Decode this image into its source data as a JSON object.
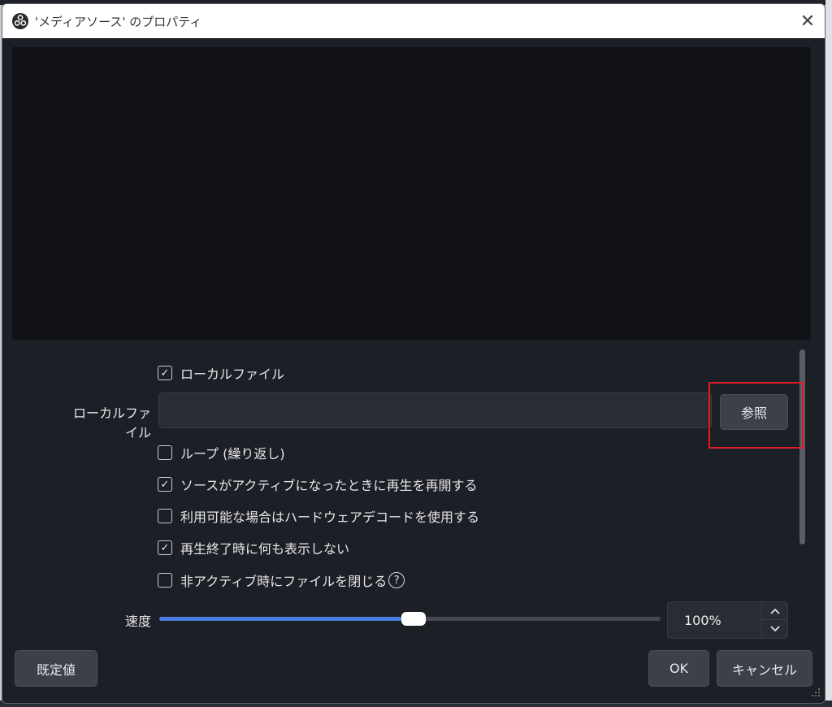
{
  "window": {
    "title": "'メディアソース' のプロパティ",
    "close_glyph": "✕"
  },
  "properties": {
    "local_file_checkbox": {
      "label": "ローカルファイル",
      "checked": true
    },
    "local_file_field": {
      "label": "ローカルファイル",
      "value": ""
    },
    "browse_button": "参照",
    "checkboxes": [
      {
        "label": "ループ (繰り返し)",
        "checked": false
      },
      {
        "label": "ソースがアクティブになったときに再生を再開する",
        "checked": true
      },
      {
        "label": "利用可能な場合はハードウェアデコードを使用する",
        "checked": false
      },
      {
        "label": "再生終了時に何も表示しない",
        "checked": true
      },
      {
        "label": "非アクティブ時にファイルを閉じる",
        "checked": false
      }
    ],
    "help_glyph": "?",
    "speed": {
      "label": "速度",
      "value_text": "100%",
      "slider_fraction": 0.5
    }
  },
  "footer": {
    "defaults_button": "既定値",
    "ok_button": "OK",
    "cancel_button": "キャンセル"
  },
  "colors": {
    "accent": "#4a7cdf",
    "highlight": "#e01b24",
    "dialog_bg": "#1d1f26",
    "preview_bg": "#111217"
  }
}
